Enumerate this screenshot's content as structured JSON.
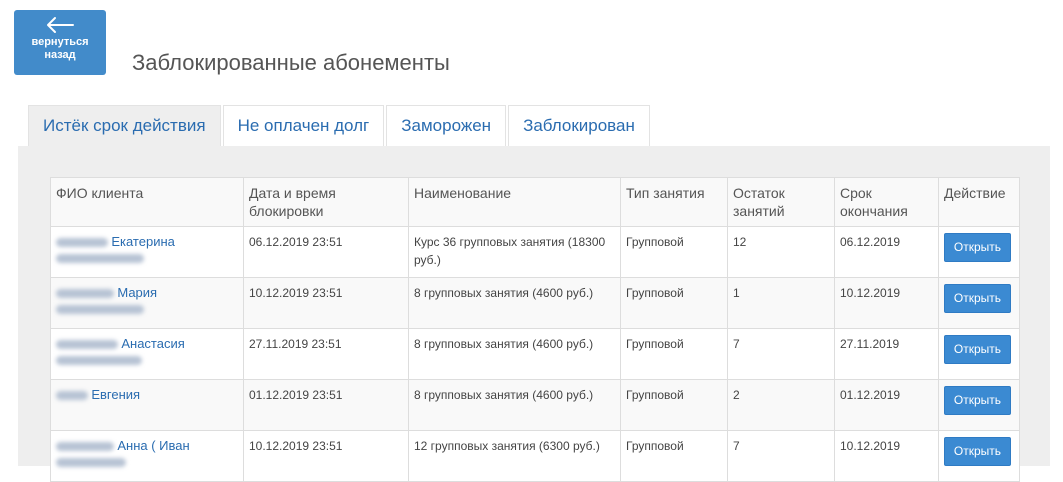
{
  "header": {
    "back_label_line1": "вернуться",
    "back_label_line2": "назад",
    "title": "Заблокированные абонементы"
  },
  "tabs": [
    {
      "label": "Истёк срок действия",
      "active": true
    },
    {
      "label": "Не оплачен долг",
      "active": false
    },
    {
      "label": "Заморожен",
      "active": false
    },
    {
      "label": "Заблокирован",
      "active": false
    }
  ],
  "table": {
    "columns": [
      "ФИО клиента",
      "Дата и время блокировки",
      "Наименование",
      "Тип занятия",
      "Остаток занятий",
      "Срок окончания",
      "Действие"
    ],
    "action_label": "Открыть",
    "rows": [
      {
        "client": "Екатерина",
        "blocked_at": "06.12.2019 23:51",
        "name": "Курс 36 групповых занятия (18300 руб.)",
        "type": "Групповой",
        "remaining": "12",
        "end_date": "06.12.2019"
      },
      {
        "client": "Мария",
        "blocked_at": "10.12.2019 23:51",
        "name": "8 групповых занятия (4600 руб.)",
        "type": "Групповой",
        "remaining": "1",
        "end_date": "10.12.2019"
      },
      {
        "client": "Анастасия",
        "blocked_at": "27.11.2019 23:51",
        "name": "8 групповых занятия (4600 руб.)",
        "type": "Групповой",
        "remaining": "7",
        "end_date": "27.11.2019"
      },
      {
        "client": "Евгения",
        "blocked_at": "01.12.2019 23:51",
        "name": "8 групповых занятия (4600 руб.)",
        "type": "Групповой",
        "remaining": "2",
        "end_date": "01.12.2019"
      },
      {
        "client": "Анна ( Иван",
        "blocked_at": "10.12.2019 23:51",
        "name": "12 групповых занятия (6300 руб.)",
        "type": "Групповой",
        "remaining": "7",
        "end_date": "10.12.2019"
      }
    ]
  }
}
